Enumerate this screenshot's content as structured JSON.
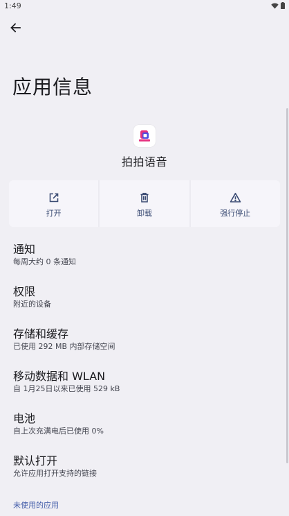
{
  "status_bar": {
    "time": "1:49"
  },
  "header": {
    "title": "应用信息"
  },
  "app": {
    "name": "拍拍语音"
  },
  "actions": [
    {
      "label": "打开",
      "icon": "open-external-icon"
    },
    {
      "label": "卸载",
      "icon": "trash-icon"
    },
    {
      "label": "强行停止",
      "icon": "warning-icon"
    }
  ],
  "preferences": [
    {
      "title": "通知",
      "summary": "每周大约 0 条通知"
    },
    {
      "title": "权限",
      "summary": "附近的设备"
    },
    {
      "title": "存储和缓存",
      "summary": "已使用 292 MB 内部存储空间"
    },
    {
      "title": "移动数据和 WLAN",
      "summary": "自 1月25日以来已使用 529 kB"
    },
    {
      "title": "电池",
      "summary": "自上次充满电后已使用 0%"
    },
    {
      "title": "默认打开",
      "summary": "允许应用打开支持的链接"
    }
  ],
  "section": {
    "unused_apps": "未使用的应用"
  },
  "colors": {
    "background": "#f0eff4",
    "accent": "#3a4b73",
    "link": "#3f5aa8"
  }
}
